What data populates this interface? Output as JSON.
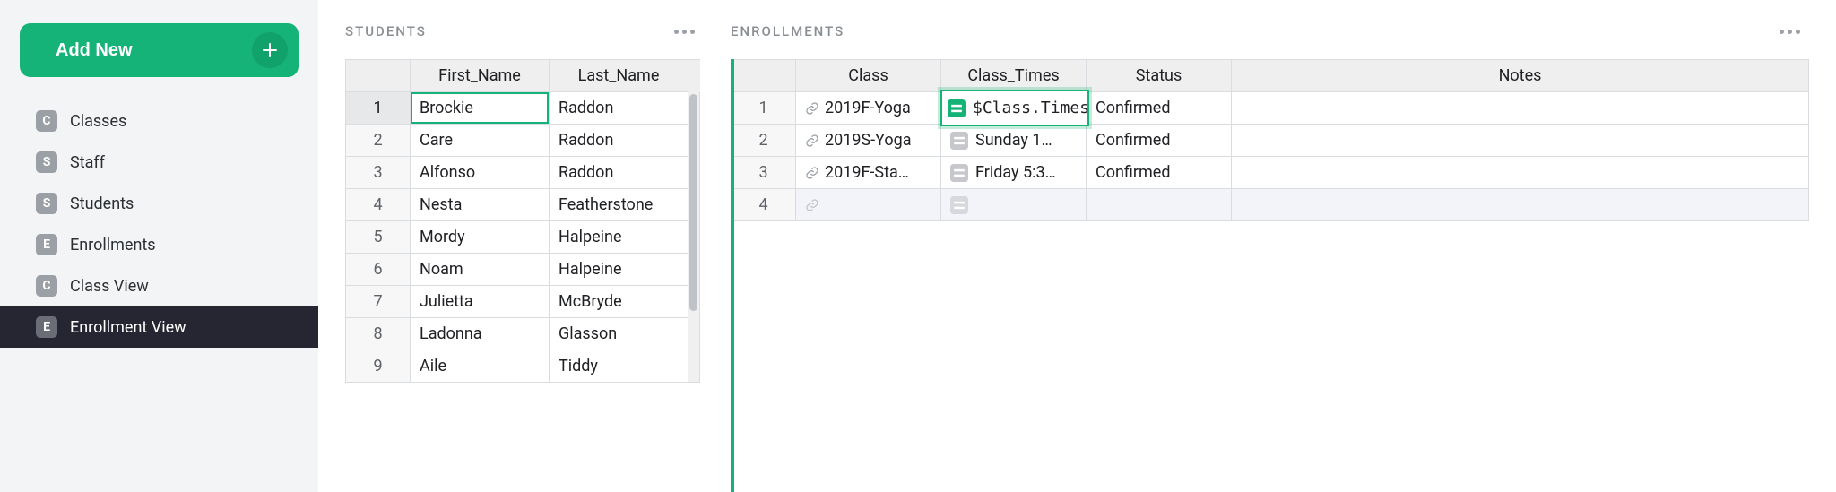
{
  "sidebar": {
    "add_label": "Add New",
    "items": [
      {
        "key": "C",
        "label": "Classes"
      },
      {
        "key": "S",
        "label": "Staff"
      },
      {
        "key": "S",
        "label": "Students"
      },
      {
        "key": "E",
        "label": "Enrollments"
      },
      {
        "key": "C",
        "label": "Class View"
      },
      {
        "key": "E",
        "label": "Enrollment View"
      }
    ]
  },
  "students": {
    "title": "STUDENTS",
    "columns": {
      "c1": "First_Name",
      "c2": "Last_Name"
    },
    "rows": [
      {
        "n": "1",
        "first": "Brockie",
        "last": "Raddon"
      },
      {
        "n": "2",
        "first": "Care",
        "last": "Raddon"
      },
      {
        "n": "3",
        "first": "Alfonso",
        "last": "Raddon"
      },
      {
        "n": "4",
        "first": "Nesta",
        "last": "Featherstone"
      },
      {
        "n": "5",
        "first": "Mordy",
        "last": "Halpeine"
      },
      {
        "n": "6",
        "first": "Noam",
        "last": "Halpeine"
      },
      {
        "n": "7",
        "first": "Julietta",
        "last": "McBryde"
      },
      {
        "n": "8",
        "first": "Ladonna",
        "last": "Glasson"
      },
      {
        "n": "9",
        "first": "Aile",
        "last": "Tiddy"
      }
    ]
  },
  "enrollments": {
    "title": "ENROLLMENTS",
    "columns": {
      "c1": "Class",
      "c2": "Class_Times",
      "c3": "Status",
      "c4": "Notes"
    },
    "rows": [
      {
        "n": "1",
        "class": "2019F-Yoga",
        "times": "$Class.Times",
        "status": "Confirmed",
        "notes": ""
      },
      {
        "n": "2",
        "class": "2019S-Yoga",
        "times": "Sunday 1…",
        "status": "Confirmed",
        "notes": ""
      },
      {
        "n": "3",
        "class": "2019F-Sta…",
        "times": "Friday 5:3…",
        "status": "Confirmed",
        "notes": ""
      },
      {
        "n": "4",
        "class": "",
        "times": "",
        "status": "",
        "notes": ""
      }
    ],
    "editing_formula": "$Class.Times"
  }
}
